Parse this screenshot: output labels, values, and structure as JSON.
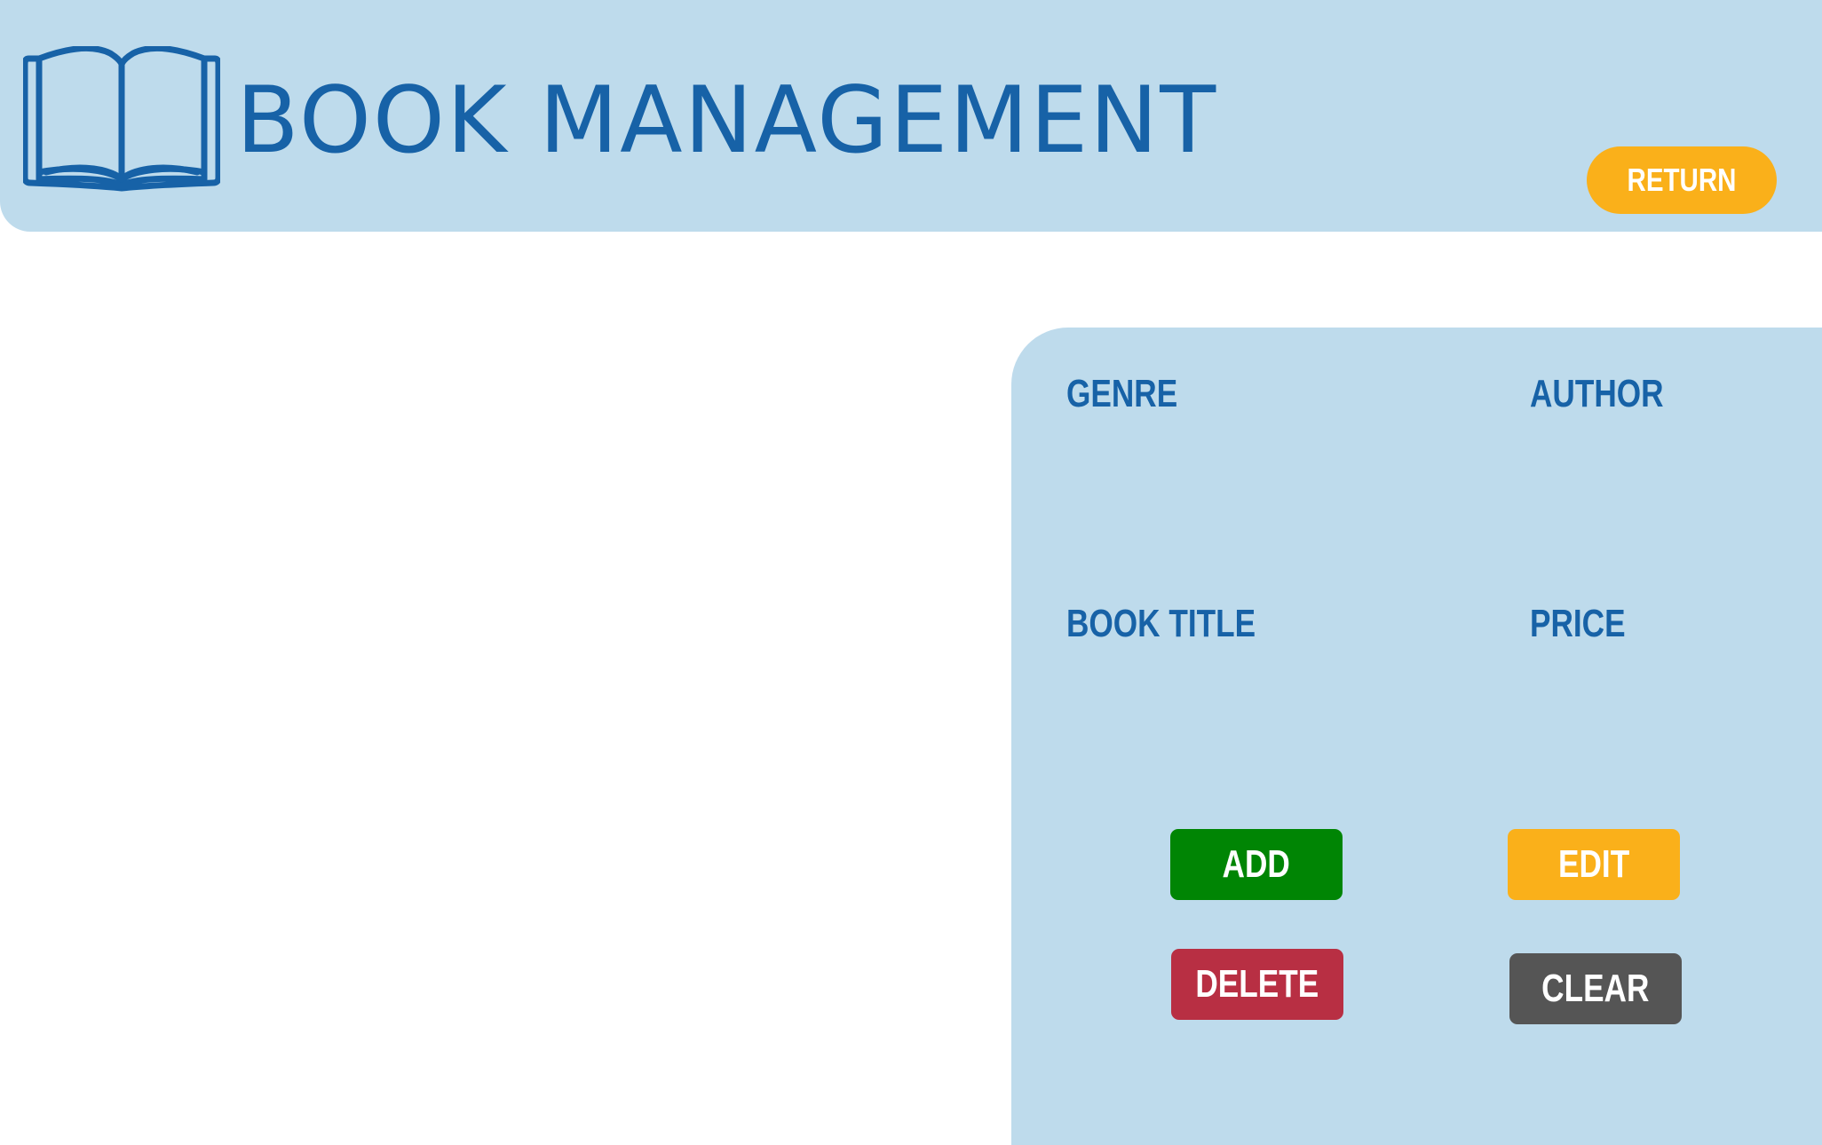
{
  "header": {
    "title": "BOOK MANAGEMENT",
    "icon": "open-book-icon",
    "return_label": "RETURN"
  },
  "form": {
    "fields": {
      "genre": "GENRE",
      "author": "AUTHOR",
      "book_title": "BOOK TITLE",
      "price": "PRICE"
    },
    "actions": {
      "add": "ADD",
      "edit": "EDIT",
      "delete": "DELETE",
      "clear": "CLEAR"
    }
  },
  "colors": {
    "panel_bg": "#bedbec",
    "brand_blue": "#1762a7",
    "accent_orange": "#fab01a",
    "add_green": "#008504",
    "delete_red": "#b82f43",
    "clear_gray": "#555555"
  }
}
